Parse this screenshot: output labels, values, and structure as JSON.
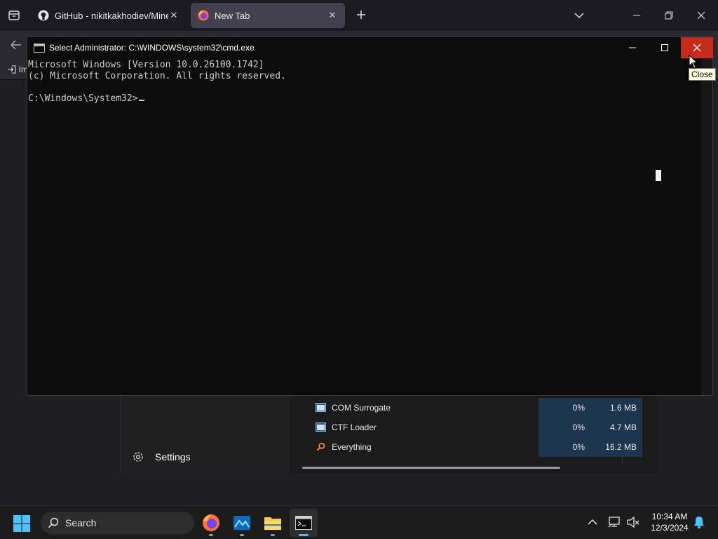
{
  "browser": {
    "tabs": [
      {
        "title": "GitHub - nikitkakhodiev/Minecraft",
        "active": false,
        "favicon": "github-icon"
      },
      {
        "title": "New Tab",
        "active": true,
        "favicon": "firefox-icon"
      }
    ],
    "import_label": "Im"
  },
  "task_manager": {
    "processes": [
      {
        "name": "COM Surrogate",
        "cpu": "0%",
        "memory": "1.6 MB",
        "icon": "window-app-icon"
      },
      {
        "name": "CTF Loader",
        "cpu": "0%",
        "memory": "4.7 MB",
        "icon": "window-app-icon"
      },
      {
        "name": "Everything",
        "cpu": "0%",
        "memory": "16.2 MB",
        "icon": "magnifier-app-icon"
      }
    ],
    "settings_label": "Settings",
    "highlight_color": "#1e3550"
  },
  "cmd": {
    "title": "Select Administrator: C:\\WINDOWS\\system32\\cmd.exe",
    "lines": [
      "Microsoft Windows [Version 10.0.26100.1742]",
      "(c) Microsoft Corporation. All rights reserved.",
      "",
      "C:\\Windows\\System32>"
    ],
    "close_color": "#c42b1c"
  },
  "tooltip": {
    "text": "Close"
  },
  "taskbar": {
    "search_label": "Search",
    "apps": [
      "firefox-icon",
      "photos-icon",
      "file-explorer-icon",
      "terminal-icon"
    ],
    "time": "10:34 AM",
    "date": "12/3/2024"
  }
}
